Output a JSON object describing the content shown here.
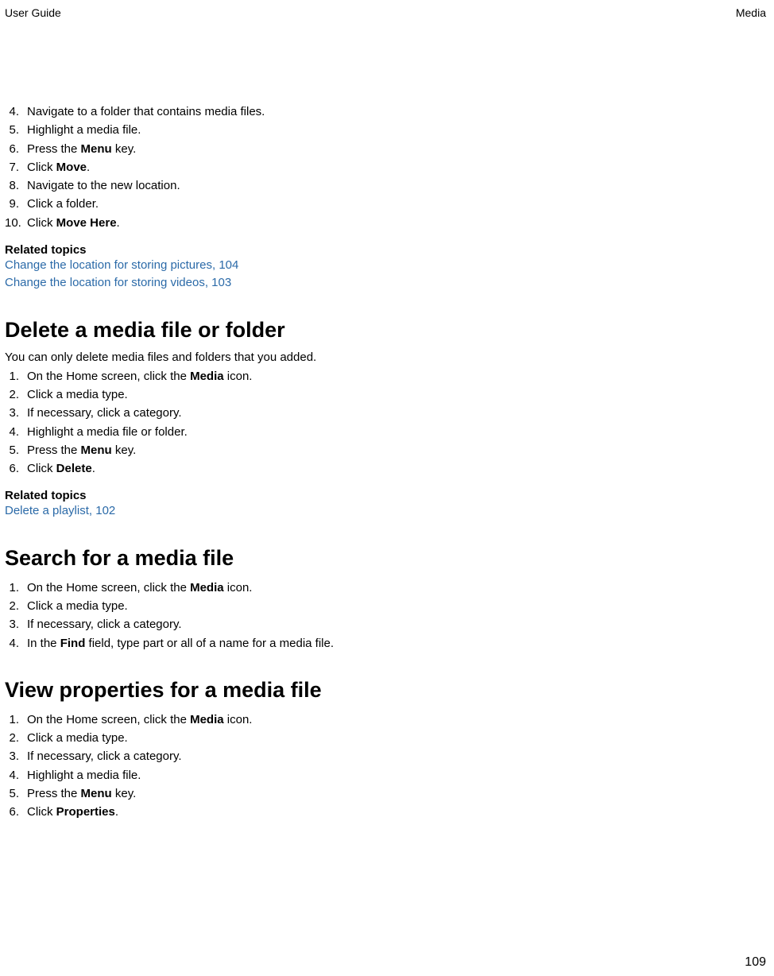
{
  "header": {
    "left": "User Guide",
    "right": "Media"
  },
  "section1": {
    "steps": [
      {
        "num": "4.",
        "pre": "Navigate to a folder that contains media files."
      },
      {
        "num": "5.",
        "pre": "Highlight a media file."
      },
      {
        "num": "6.",
        "pre": "Press the ",
        "bold": "Menu",
        "post": " key."
      },
      {
        "num": "7.",
        "pre": "Click ",
        "bold": "Move",
        "post": "."
      },
      {
        "num": "8.",
        "pre": "Navigate to the new location."
      },
      {
        "num": "9.",
        "pre": "Click a folder."
      },
      {
        "num": "10.",
        "pre": "Click ",
        "bold": "Move Here",
        "post": "."
      }
    ],
    "related_heading": "Related topics",
    "links": [
      "Change the location for storing pictures, 104",
      "Change the location for storing videos, 103"
    ]
  },
  "section2": {
    "heading": "Delete a media file or folder",
    "intro": "You can only delete media files and folders that you added.",
    "steps": [
      {
        "num": "1.",
        "pre": "On the Home screen, click the ",
        "bold": "Media",
        "post": " icon."
      },
      {
        "num": "2.",
        "pre": "Click a media type."
      },
      {
        "num": "3.",
        "pre": "If necessary, click a category."
      },
      {
        "num": "4.",
        "pre": "Highlight a media file or folder."
      },
      {
        "num": "5.",
        "pre": "Press the ",
        "bold": "Menu",
        "post": " key."
      },
      {
        "num": "6.",
        "pre": "Click ",
        "bold": "Delete",
        "post": "."
      }
    ],
    "related_heading": "Related topics",
    "links": [
      "Delete a playlist, 102"
    ]
  },
  "section3": {
    "heading": "Search for a media file",
    "steps": [
      {
        "num": "1.",
        "pre": "On the Home screen, click the ",
        "bold": "Media",
        "post": " icon."
      },
      {
        "num": "2.",
        "pre": "Click a media type."
      },
      {
        "num": "3.",
        "pre": "If necessary, click a category."
      },
      {
        "num": "4.",
        "pre": "In the ",
        "bold": "Find",
        "post": " field, type part or all of a name for a media file."
      }
    ]
  },
  "section4": {
    "heading": "View properties for a media file",
    "steps": [
      {
        "num": "1.",
        "pre": "On the Home screen, click the ",
        "bold": "Media",
        "post": " icon."
      },
      {
        "num": "2.",
        "pre": "Click a media type."
      },
      {
        "num": "3.",
        "pre": "If necessary, click a category."
      },
      {
        "num": "4.",
        "pre": "Highlight a media file."
      },
      {
        "num": "5.",
        "pre": "Press the ",
        "bold": "Menu",
        "post": " key."
      },
      {
        "num": "6.",
        "pre": "Click ",
        "bold": "Properties",
        "post": "."
      }
    ]
  },
  "footer": {
    "page_number": "109"
  }
}
